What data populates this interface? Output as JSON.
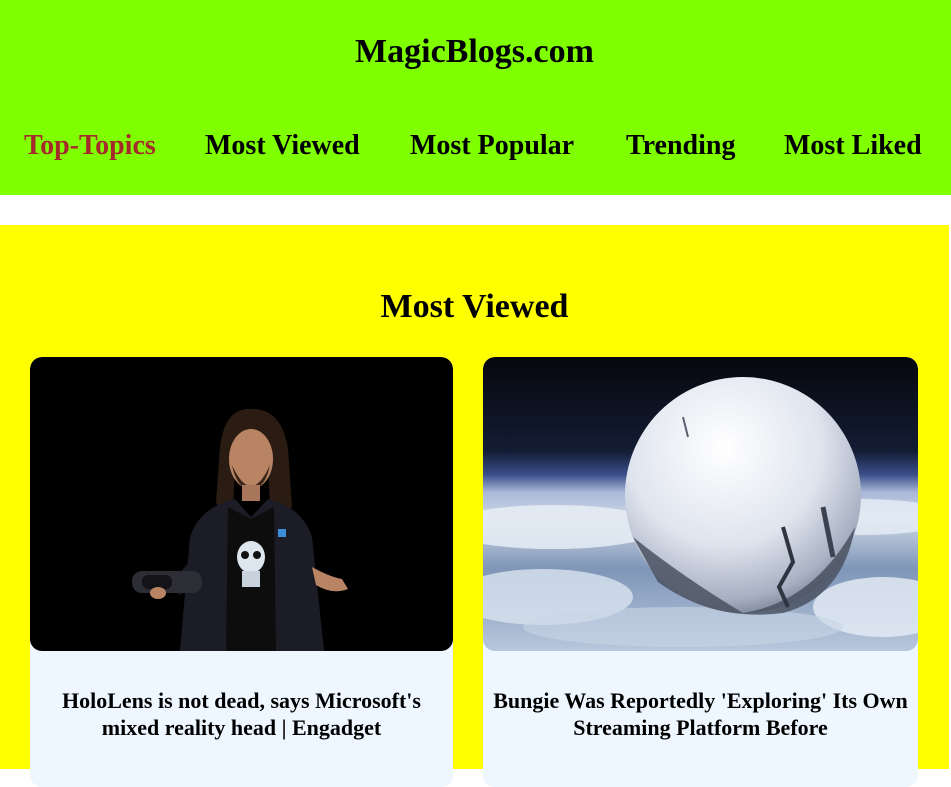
{
  "site": {
    "title": "MagicBlogs.com"
  },
  "nav": {
    "items": [
      {
        "label": "Top-Topics",
        "active": true
      },
      {
        "label": "Most Viewed",
        "active": false
      },
      {
        "label": "Most Popular",
        "active": false
      },
      {
        "label": "Trending",
        "active": false
      },
      {
        "label": "Most Liked",
        "active": false
      }
    ]
  },
  "section": {
    "title": "Most Viewed"
  },
  "cards": [
    {
      "title": "HoloLens is not dead, says Microsoft's mixed reality head | Engadget",
      "image": "presenter-on-stage-holding-headset"
    },
    {
      "title": "Bungie Was Reportedly 'Exploring' Its Own Streaming Platform Before",
      "image": "white-sphere-above-planet"
    }
  ],
  "colors": {
    "header_bg": "#7fff00",
    "main_bg": "#ffff00",
    "card_bg": "#eef7ff",
    "nav_active": "#a52a2a",
    "text": "#000000"
  }
}
